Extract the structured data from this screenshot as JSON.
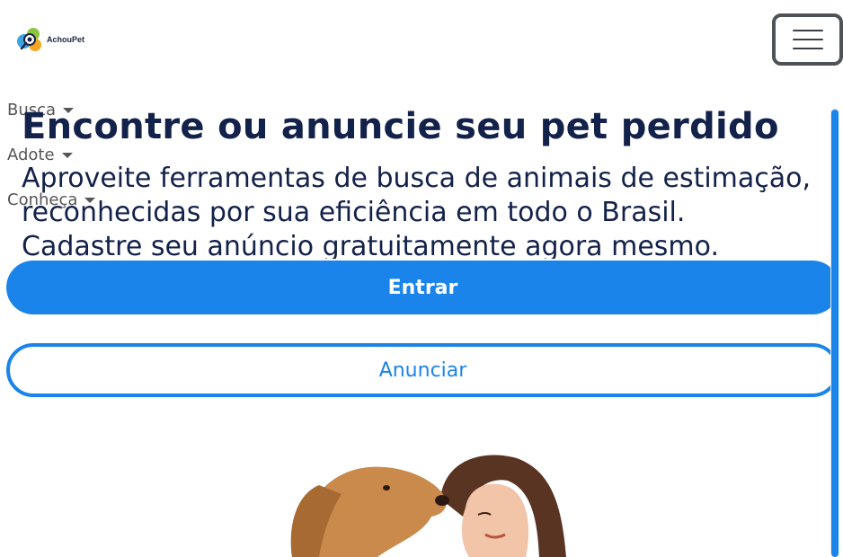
{
  "header": {
    "logo_text": "AchouPet"
  },
  "nav": {
    "items": [
      {
        "label": "Busca"
      },
      {
        "label": "Adote"
      },
      {
        "label": "Conheça"
      }
    ]
  },
  "hero": {
    "title": "Encontre ou anuncie seu pet perdido",
    "subtitle": "Aproveite ferramentas de busca de animais de estimação, reconhecidas por sua eficiência em todo o Brasil. Cadastre seu anúncio gratuitamente agora mesmo.",
    "primary_button": "Entrar",
    "secondary_button": "Anunciar"
  },
  "colors": {
    "accent": "#1a84ea",
    "title": "#13224a"
  },
  "icons": {
    "menu": "hamburger-icon",
    "logo": "magnifier-paw-logo",
    "dropdown": "caret-down-icon"
  }
}
